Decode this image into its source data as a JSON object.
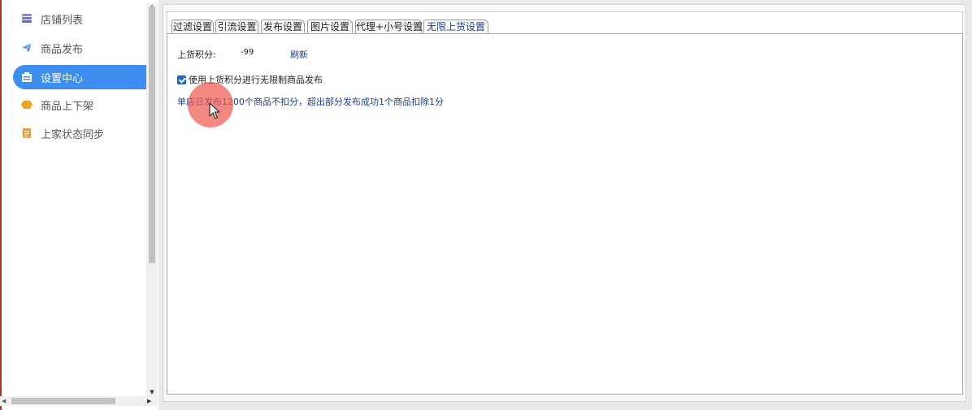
{
  "sidebar": {
    "items": [
      {
        "label": "店铺列表",
        "icon": "store-list-icon",
        "active": false
      },
      {
        "label": "商品发布",
        "icon": "paper-plane-icon",
        "active": false
      },
      {
        "label": "设置中心",
        "icon": "settings-center-icon",
        "active": true
      },
      {
        "label": "商品上下架",
        "icon": "shelf-toggle-icon",
        "active": false
      },
      {
        "label": "上家状态同步",
        "icon": "sync-document-icon",
        "active": false
      }
    ]
  },
  "tabs": [
    {
      "label": "过滤设置",
      "active": false
    },
    {
      "label": "引流设置",
      "active": false
    },
    {
      "label": "发布设置",
      "active": false
    },
    {
      "label": "图片设置",
      "active": false
    },
    {
      "label": "代理+小号设置",
      "active": false
    },
    {
      "label": "无限上货设置",
      "active": true
    }
  ],
  "main": {
    "points_label": "上货积分:",
    "points_value": "-99",
    "refresh_label": "刷新",
    "unlimited_checkbox_label": "使用上货积分进行无限制商品发布",
    "unlimited_checkbox_checked": true,
    "info_text": "单店日发布1200个商品不扣分，超出部分发布成功1个商品扣除1分"
  },
  "colors": {
    "accent": "#3d8ef0",
    "link": "#1a3f8f",
    "cursor_highlight": "#ee5c50"
  }
}
